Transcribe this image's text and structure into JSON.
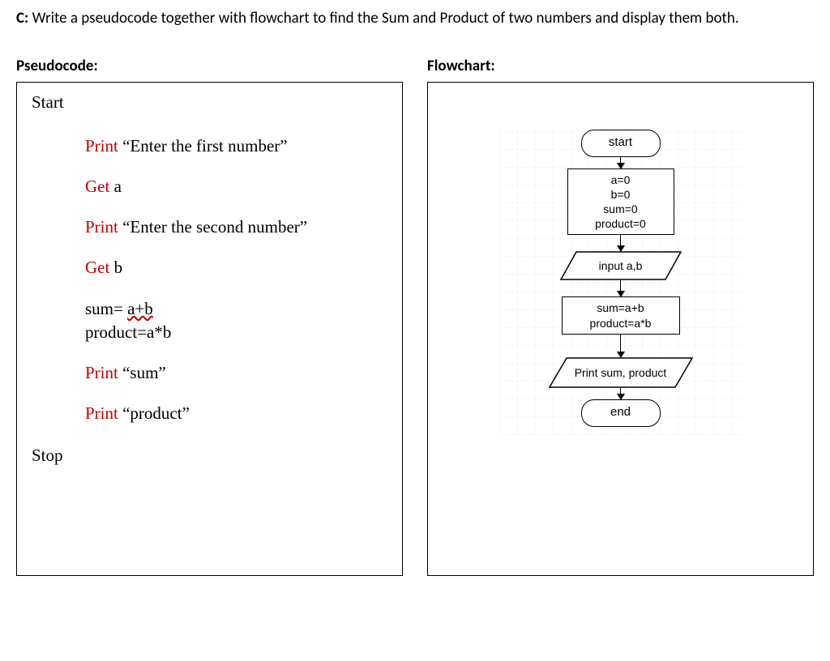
{
  "question": {
    "label": "C:",
    "text": "Write a pseudocode together with flowchart to find the Sum and Product of two numbers and display them both."
  },
  "left": {
    "heading": "Pseudocode:",
    "start": "Start",
    "stop": "Stop",
    "lines": {
      "print1_kw": "Print",
      "print1_txt": " “Enter the first number”",
      "get_a_kw": "Get",
      "get_a_txt": " a",
      "print2_kw": "Print",
      "print2_txt": " “Enter the second number”",
      "get_b_kw": "Get",
      "get_b_txt": " b",
      "sum_lhs": "sum= ",
      "sum_rhs": "a+b",
      "product": "product=a*b",
      "printsum_kw": "Print",
      "printsum_txt": " “sum”",
      "printprod_kw": "Print",
      "printprod_txt": " “product”"
    }
  },
  "right": {
    "heading": "Flowchart:",
    "nodes": {
      "start": "start",
      "init1": "a=0",
      "init2": "b=0",
      "init3": "sum=0",
      "init4": "product=0",
      "input": "input a,b",
      "calc1": "sum=a+b",
      "calc2": "product=a*b",
      "output": "Print sum, product",
      "end": "end"
    }
  }
}
